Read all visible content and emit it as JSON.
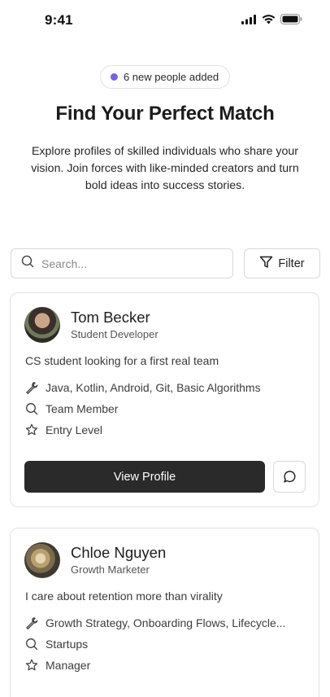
{
  "status_bar": {
    "time": "9:41",
    "icons": [
      "signal-icon",
      "wifi-icon",
      "battery-icon"
    ]
  },
  "header": {
    "badge_text": "6 new people added",
    "badge_dot_color": "#7a63e0",
    "title": "Find Your Perfect Match",
    "subtitle": "Explore profiles of skilled individuals who share your vision. Join forces with like-minded creators and turn bold ideas into success stories."
  },
  "search": {
    "placeholder": "Search...",
    "value": "",
    "filter_label": "Filter"
  },
  "profiles": [
    {
      "name": "Tom Becker",
      "role": "Student Developer",
      "bio": "CS student looking for a first real team",
      "skills": "Java, Kotlin, Android, Git, Basic Algorithms",
      "looking_for": "Team Member",
      "level": "Entry Level",
      "view_label": "View Profile"
    },
    {
      "name": "Chloe Nguyen",
      "role": "Growth Marketer",
      "bio": "I care about retention more than virality",
      "skills": "Growth Strategy, Onboarding Flows, Lifecycle...",
      "looking_for": "Startups",
      "level": "Manager"
    }
  ],
  "colors": {
    "primary_button": "#2a2a2a",
    "accent": "#7a63e0"
  }
}
